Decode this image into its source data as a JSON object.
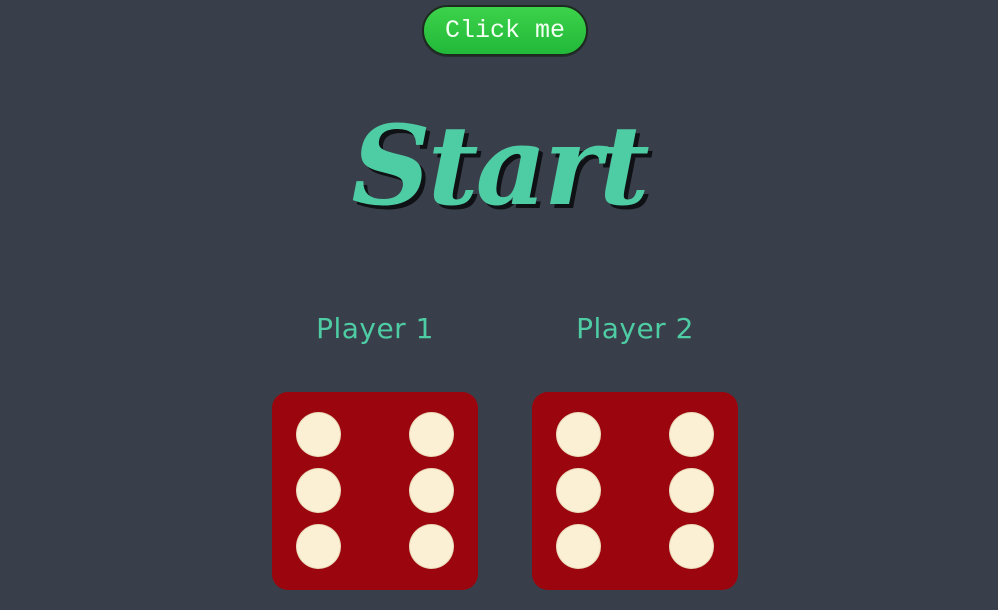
{
  "button": {
    "label": "Click me"
  },
  "title": "Start",
  "players": [
    {
      "label": "Player 1",
      "die_value": 6
    },
    {
      "label": "Player 2",
      "die_value": 6
    }
  ],
  "colors": {
    "background": "#393f4a",
    "accent": "#4ecca3",
    "button": "#2ec544",
    "die": "#9b050d",
    "pip": "#fbefd4"
  }
}
